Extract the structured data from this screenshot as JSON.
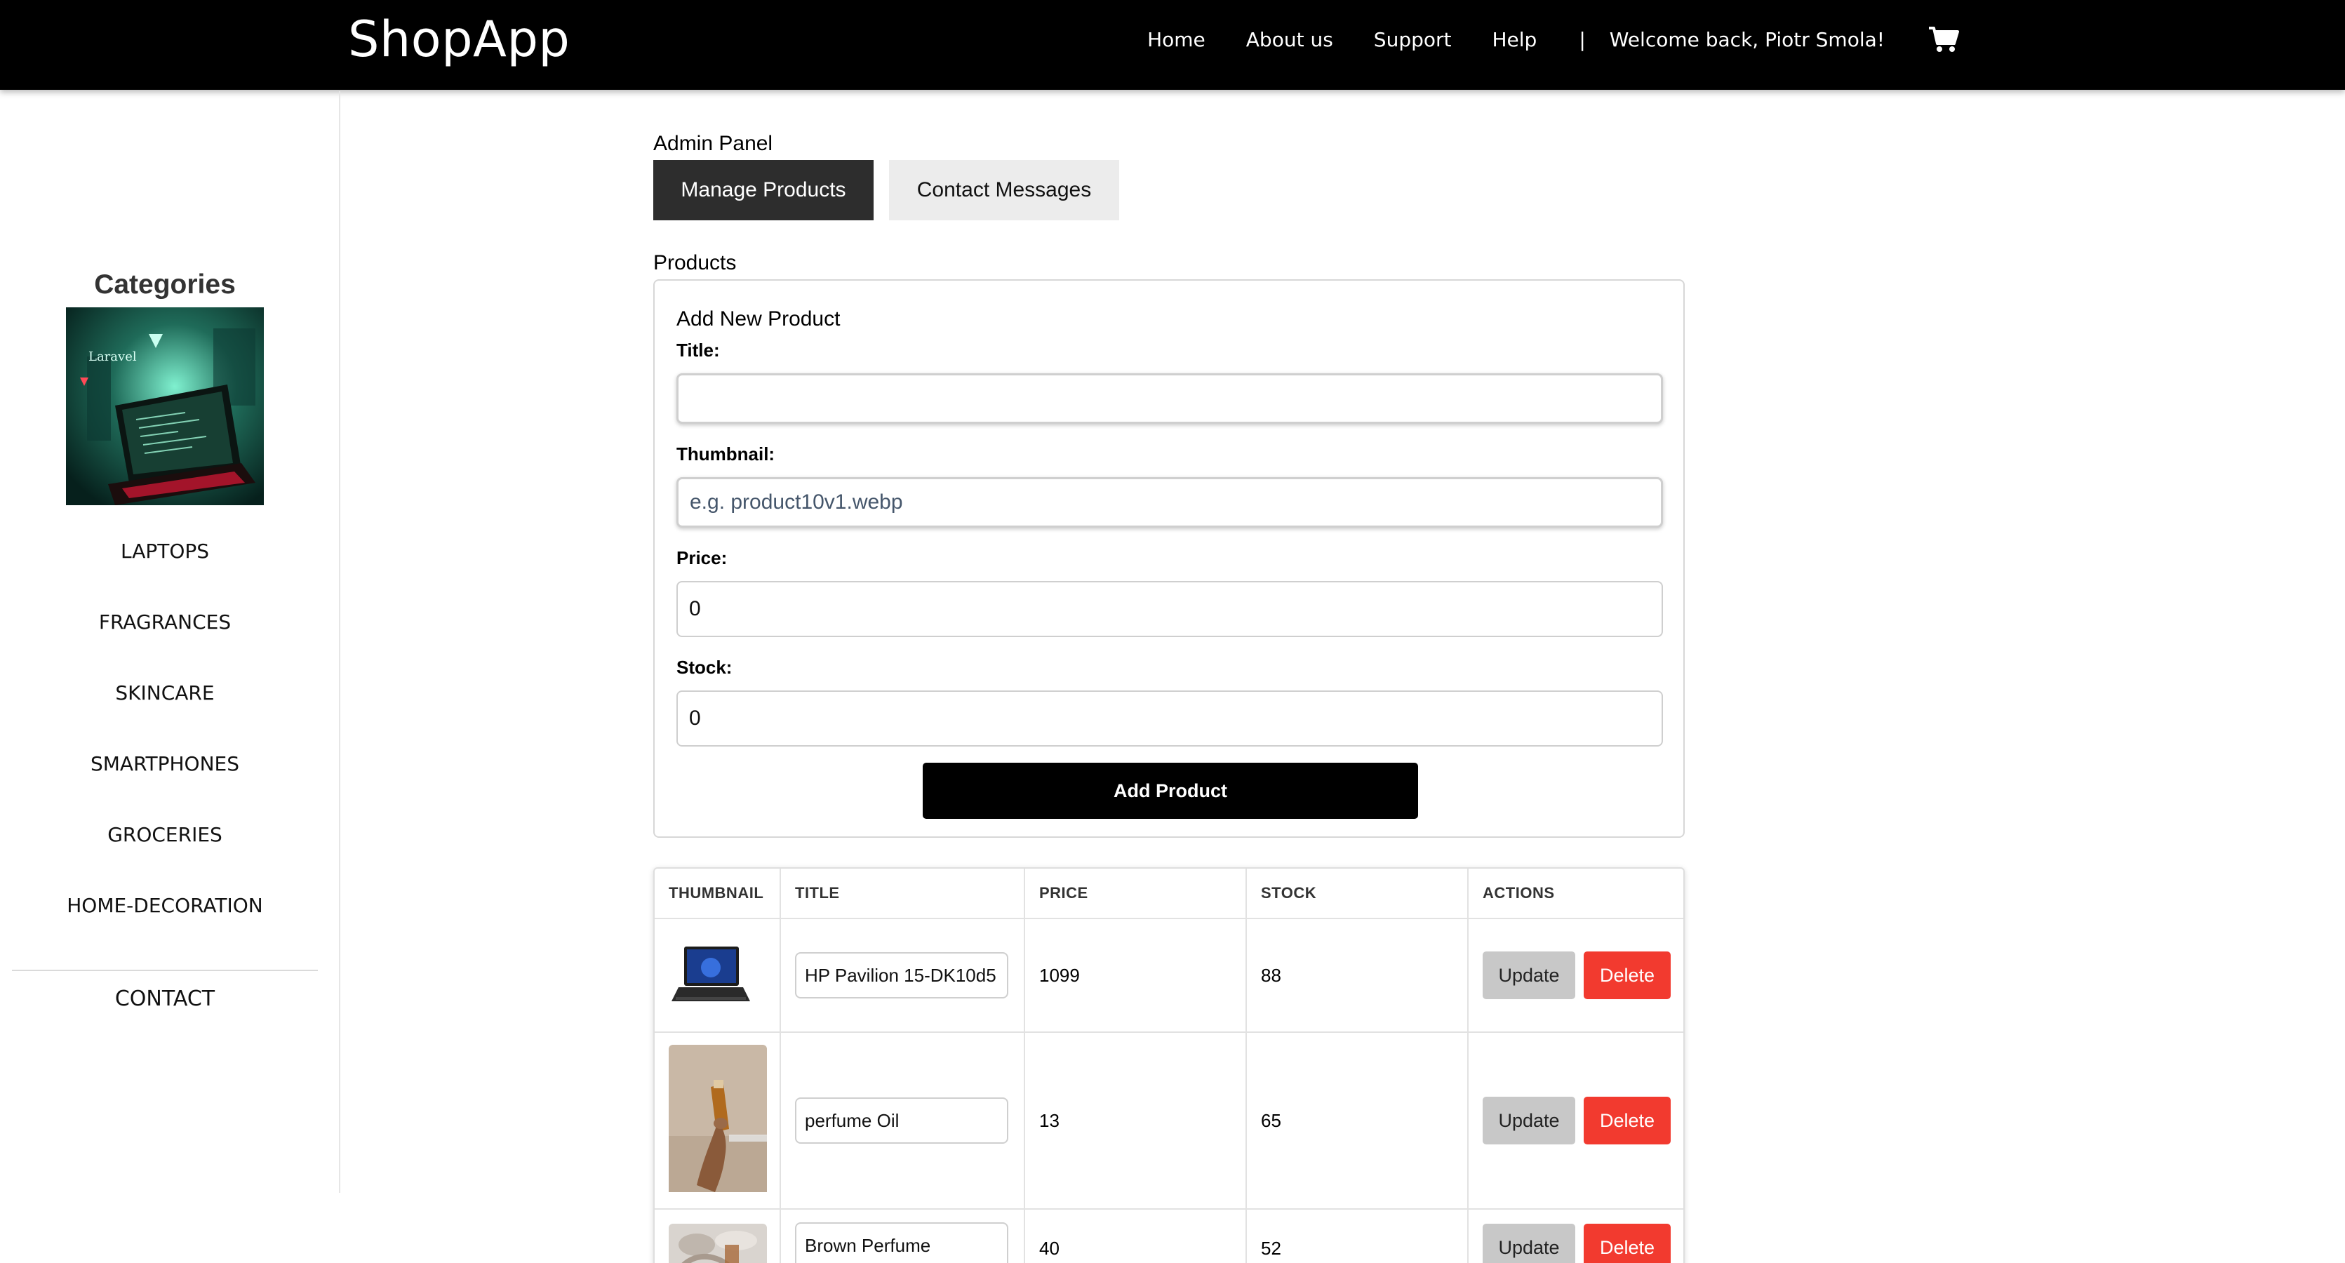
{
  "header": {
    "brand": "ShopApp",
    "nav": [
      "Home",
      "About us",
      "Support",
      "Help"
    ],
    "separator": "|",
    "welcome": "Welcome back, Piotr Smola!",
    "cart_icon": "shopping-cart-icon"
  },
  "sidebar": {
    "categories_title": "Categories",
    "category_image_text": "Laravel",
    "categories": [
      "LAPTOPS",
      "FRAGRANCES",
      "SKINCARE",
      "SMARTPHONES",
      "GROCERIES",
      "HOME-DECORATION"
    ],
    "contact": "CONTACT"
  },
  "admin": {
    "title": "Admin Panel",
    "tabs": [
      {
        "label": "Manage Products",
        "active": true
      },
      {
        "label": "Contact Messages",
        "active": false
      }
    ]
  },
  "products": {
    "title": "Products",
    "form": {
      "heading": "Add New Product",
      "title_label": "Title:",
      "title_value": "",
      "thumbnail_label": "Thumbnail:",
      "thumbnail_placeholder": "e.g. product10v1.webp",
      "price_label": "Price:",
      "price_value": "0",
      "stock_label": "Stock:",
      "stock_value": "0",
      "submit_label": "Add Product"
    },
    "table": {
      "columns": [
        "THUMBNAIL",
        "TITLE",
        "PRICE",
        "STOCK",
        "ACTIONS"
      ],
      "update_label": "Update",
      "delete_label": "Delete",
      "rows": [
        {
          "title": "HP Pavilion 15-DK10d5",
          "price": "1099",
          "stock": "88"
        },
        {
          "title": "perfume Oil",
          "price": "13",
          "stock": "65"
        },
        {
          "title": "Brown Perfume",
          "price": "40",
          "stock": "52"
        }
      ]
    }
  },
  "colors": {
    "topbar": "#000000",
    "active_tab": "#2d2d2d",
    "inactive_tab": "#ececec",
    "delete_button": "#f23a2f",
    "update_button": "#c8c8c8",
    "add_button": "#000000"
  }
}
